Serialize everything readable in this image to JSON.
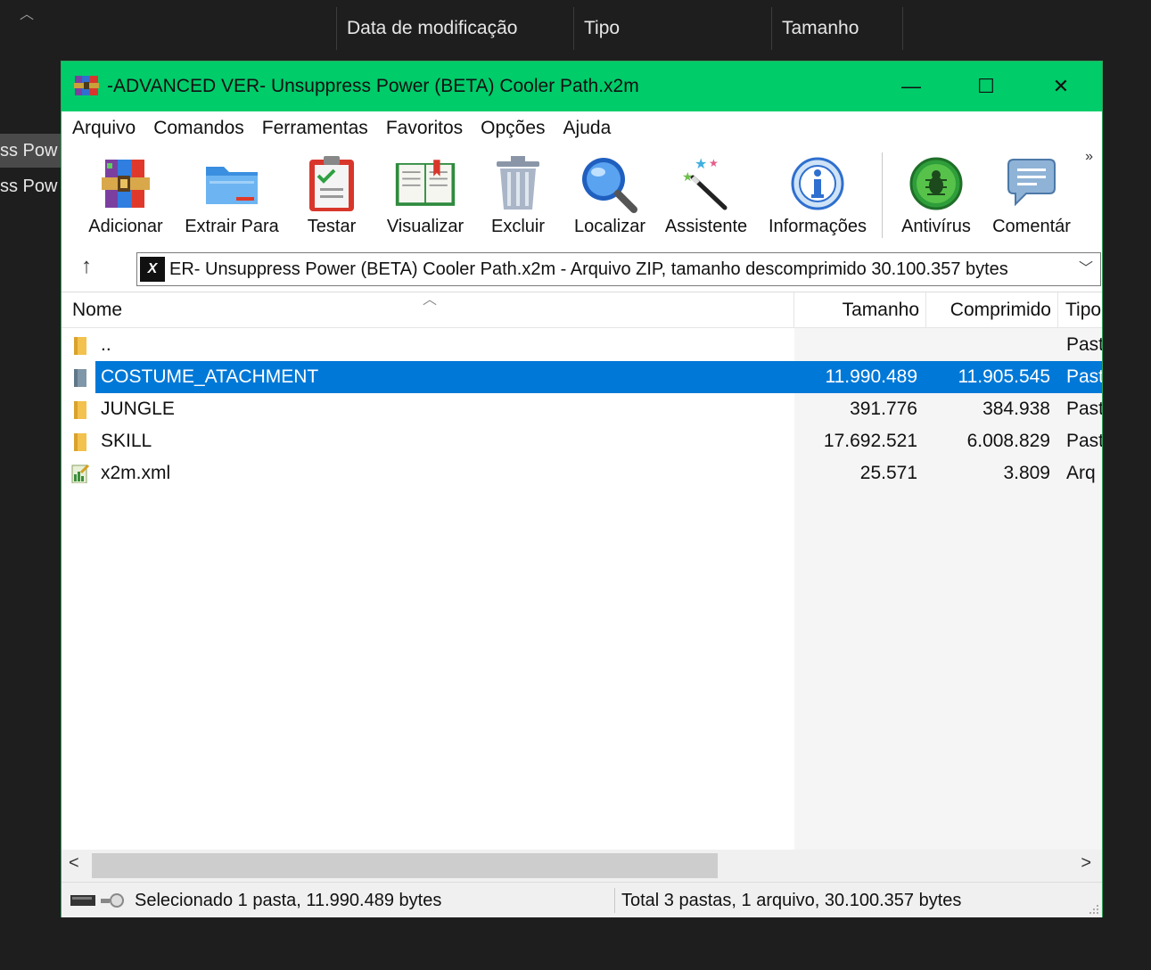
{
  "background_explorer": {
    "columns": [
      "Data de modificação",
      "Tipo",
      "Tamanho"
    ],
    "left_items": [
      "ss Pow",
      "ss Pow"
    ]
  },
  "window": {
    "title": "-ADVANCED VER- Unsuppress Power (BETA) Cooler Path.x2m",
    "controls": {
      "minimize": "—",
      "maximize": "☐",
      "close": "✕"
    }
  },
  "menu": [
    "Arquivo",
    "Comandos",
    "Ferramentas",
    "Favoritos",
    "Opções",
    "Ajuda"
  ],
  "toolbar": {
    "buttons": [
      {
        "label": "Adicionar",
        "icon": "archive-add-icon"
      },
      {
        "label": "Extrair Para",
        "icon": "extract-folder-icon"
      },
      {
        "label": "Testar",
        "icon": "test-clipboard-icon"
      },
      {
        "label": "Visualizar",
        "icon": "book-view-icon"
      },
      {
        "label": "Excluir",
        "icon": "trash-icon"
      },
      {
        "label": "Localizar",
        "icon": "magnifier-icon"
      },
      {
        "label": "Assistente",
        "icon": "wizard-wand-icon"
      },
      {
        "label": "Informações",
        "icon": "info-icon"
      },
      {
        "label": "Antivírus",
        "icon": "antivirus-bug-icon"
      },
      {
        "label": "Comentár",
        "icon": "comment-icon"
      }
    ],
    "more": "»"
  },
  "address": {
    "icon_text": "X",
    "text": "ER- Unsuppress Power (BETA) Cooler Path.x2m - Arquivo ZIP, tamanho descomprimido 30.100.357 bytes"
  },
  "list": {
    "headers": {
      "name": "Nome",
      "size": "Tamanho",
      "compressed": "Comprimido",
      "type": "Tipo"
    },
    "rows": [
      {
        "name": "..",
        "size": "",
        "compressed": "",
        "type": "Past",
        "icon": "folder-icon"
      },
      {
        "name": "COSTUME_ATACHMENT",
        "size": "11.990.489",
        "compressed": "11.905.545",
        "type": "Past",
        "icon": "folder-icon",
        "selected": true
      },
      {
        "name": "JUNGLE",
        "size": "391.776",
        "compressed": "384.938",
        "type": "Past",
        "icon": "folder-icon"
      },
      {
        "name": "SKILL",
        "size": "17.692.521",
        "compressed": "6.008.829",
        "type": "Past",
        "icon": "folder-icon"
      },
      {
        "name": "x2m.xml",
        "size": "25.571",
        "compressed": "3.809",
        "type": "Arq",
        "icon": "xml-file-icon"
      }
    ]
  },
  "status": {
    "left": "Selecionado 1 pasta, 11.990.489 bytes",
    "right": "Total 3 pastas, 1 arquivo, 30.100.357 bytes"
  }
}
